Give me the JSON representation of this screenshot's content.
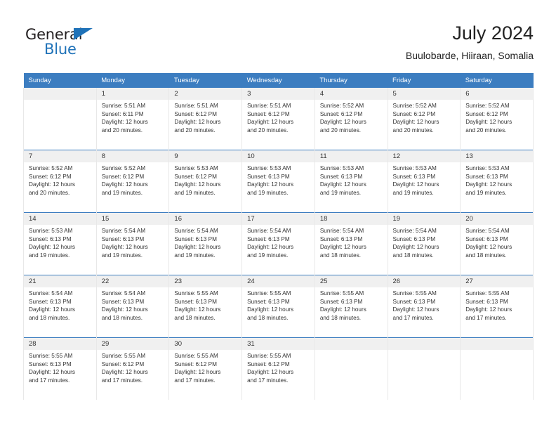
{
  "brand": {
    "name_part1": "General",
    "name_part2": "Blue",
    "triangle_icon": "triangle-icon",
    "accent_color": "#1f72b8"
  },
  "header": {
    "title": "July 2024",
    "subtitle": "Buulobarde, Hiiraan, Somalia"
  },
  "calendar": {
    "header_bg": "#3c7dc0",
    "daynum_bg": "#f0f0f0",
    "weekday_headers": [
      "Sunday",
      "Monday",
      "Tuesday",
      "Wednesday",
      "Thursday",
      "Friday",
      "Saturday"
    ],
    "weeks": [
      [
        {
          "day": "",
          "sunrise": "",
          "sunset": "",
          "daylight1": "",
          "daylight2": "",
          "blank": true
        },
        {
          "day": "1",
          "sunrise": "Sunrise: 5:51 AM",
          "sunset": "Sunset: 6:11 PM",
          "daylight1": "Daylight: 12 hours",
          "daylight2": "and 20 minutes."
        },
        {
          "day": "2",
          "sunrise": "Sunrise: 5:51 AM",
          "sunset": "Sunset: 6:12 PM",
          "daylight1": "Daylight: 12 hours",
          "daylight2": "and 20 minutes."
        },
        {
          "day": "3",
          "sunrise": "Sunrise: 5:51 AM",
          "sunset": "Sunset: 6:12 PM",
          "daylight1": "Daylight: 12 hours",
          "daylight2": "and 20 minutes."
        },
        {
          "day": "4",
          "sunrise": "Sunrise: 5:52 AM",
          "sunset": "Sunset: 6:12 PM",
          "daylight1": "Daylight: 12 hours",
          "daylight2": "and 20 minutes."
        },
        {
          "day": "5",
          "sunrise": "Sunrise: 5:52 AM",
          "sunset": "Sunset: 6:12 PM",
          "daylight1": "Daylight: 12 hours",
          "daylight2": "and 20 minutes."
        },
        {
          "day": "6",
          "sunrise": "Sunrise: 5:52 AM",
          "sunset": "Sunset: 6:12 PM",
          "daylight1": "Daylight: 12 hours",
          "daylight2": "and 20 minutes."
        }
      ],
      [
        {
          "day": "7",
          "sunrise": "Sunrise: 5:52 AM",
          "sunset": "Sunset: 6:12 PM",
          "daylight1": "Daylight: 12 hours",
          "daylight2": "and 20 minutes."
        },
        {
          "day": "8",
          "sunrise": "Sunrise: 5:52 AM",
          "sunset": "Sunset: 6:12 PM",
          "daylight1": "Daylight: 12 hours",
          "daylight2": "and 19 minutes."
        },
        {
          "day": "9",
          "sunrise": "Sunrise: 5:53 AM",
          "sunset": "Sunset: 6:12 PM",
          "daylight1": "Daylight: 12 hours",
          "daylight2": "and 19 minutes."
        },
        {
          "day": "10",
          "sunrise": "Sunrise: 5:53 AM",
          "sunset": "Sunset: 6:13 PM",
          "daylight1": "Daylight: 12 hours",
          "daylight2": "and 19 minutes."
        },
        {
          "day": "11",
          "sunrise": "Sunrise: 5:53 AM",
          "sunset": "Sunset: 6:13 PM",
          "daylight1": "Daylight: 12 hours",
          "daylight2": "and 19 minutes."
        },
        {
          "day": "12",
          "sunrise": "Sunrise: 5:53 AM",
          "sunset": "Sunset: 6:13 PM",
          "daylight1": "Daylight: 12 hours",
          "daylight2": "and 19 minutes."
        },
        {
          "day": "13",
          "sunrise": "Sunrise: 5:53 AM",
          "sunset": "Sunset: 6:13 PM",
          "daylight1": "Daylight: 12 hours",
          "daylight2": "and 19 minutes."
        }
      ],
      [
        {
          "day": "14",
          "sunrise": "Sunrise: 5:53 AM",
          "sunset": "Sunset: 6:13 PM",
          "daylight1": "Daylight: 12 hours",
          "daylight2": "and 19 minutes."
        },
        {
          "day": "15",
          "sunrise": "Sunrise: 5:54 AM",
          "sunset": "Sunset: 6:13 PM",
          "daylight1": "Daylight: 12 hours",
          "daylight2": "and 19 minutes."
        },
        {
          "day": "16",
          "sunrise": "Sunrise: 5:54 AM",
          "sunset": "Sunset: 6:13 PM",
          "daylight1": "Daylight: 12 hours",
          "daylight2": "and 19 minutes."
        },
        {
          "day": "17",
          "sunrise": "Sunrise: 5:54 AM",
          "sunset": "Sunset: 6:13 PM",
          "daylight1": "Daylight: 12 hours",
          "daylight2": "and 19 minutes."
        },
        {
          "day": "18",
          "sunrise": "Sunrise: 5:54 AM",
          "sunset": "Sunset: 6:13 PM",
          "daylight1": "Daylight: 12 hours",
          "daylight2": "and 18 minutes."
        },
        {
          "day": "19",
          "sunrise": "Sunrise: 5:54 AM",
          "sunset": "Sunset: 6:13 PM",
          "daylight1": "Daylight: 12 hours",
          "daylight2": "and 18 minutes."
        },
        {
          "day": "20",
          "sunrise": "Sunrise: 5:54 AM",
          "sunset": "Sunset: 6:13 PM",
          "daylight1": "Daylight: 12 hours",
          "daylight2": "and 18 minutes."
        }
      ],
      [
        {
          "day": "21",
          "sunrise": "Sunrise: 5:54 AM",
          "sunset": "Sunset: 6:13 PM",
          "daylight1": "Daylight: 12 hours",
          "daylight2": "and 18 minutes."
        },
        {
          "day": "22",
          "sunrise": "Sunrise: 5:54 AM",
          "sunset": "Sunset: 6:13 PM",
          "daylight1": "Daylight: 12 hours",
          "daylight2": "and 18 minutes."
        },
        {
          "day": "23",
          "sunrise": "Sunrise: 5:55 AM",
          "sunset": "Sunset: 6:13 PM",
          "daylight1": "Daylight: 12 hours",
          "daylight2": "and 18 minutes."
        },
        {
          "day": "24",
          "sunrise": "Sunrise: 5:55 AM",
          "sunset": "Sunset: 6:13 PM",
          "daylight1": "Daylight: 12 hours",
          "daylight2": "and 18 minutes."
        },
        {
          "day": "25",
          "sunrise": "Sunrise: 5:55 AM",
          "sunset": "Sunset: 6:13 PM",
          "daylight1": "Daylight: 12 hours",
          "daylight2": "and 18 minutes."
        },
        {
          "day": "26",
          "sunrise": "Sunrise: 5:55 AM",
          "sunset": "Sunset: 6:13 PM",
          "daylight1": "Daylight: 12 hours",
          "daylight2": "and 17 minutes."
        },
        {
          "day": "27",
          "sunrise": "Sunrise: 5:55 AM",
          "sunset": "Sunset: 6:13 PM",
          "daylight1": "Daylight: 12 hours",
          "daylight2": "and 17 minutes."
        }
      ],
      [
        {
          "day": "28",
          "sunrise": "Sunrise: 5:55 AM",
          "sunset": "Sunset: 6:13 PM",
          "daylight1": "Daylight: 12 hours",
          "daylight2": "and 17 minutes."
        },
        {
          "day": "29",
          "sunrise": "Sunrise: 5:55 AM",
          "sunset": "Sunset: 6:12 PM",
          "daylight1": "Daylight: 12 hours",
          "daylight2": "and 17 minutes."
        },
        {
          "day": "30",
          "sunrise": "Sunrise: 5:55 AM",
          "sunset": "Sunset: 6:12 PM",
          "daylight1": "Daylight: 12 hours",
          "daylight2": "and 17 minutes."
        },
        {
          "day": "31",
          "sunrise": "Sunrise: 5:55 AM",
          "sunset": "Sunset: 6:12 PM",
          "daylight1": "Daylight: 12 hours",
          "daylight2": "and 17 minutes."
        },
        {
          "day": "",
          "sunrise": "",
          "sunset": "",
          "daylight1": "",
          "daylight2": "",
          "blank": true
        },
        {
          "day": "",
          "sunrise": "",
          "sunset": "",
          "daylight1": "",
          "daylight2": "",
          "blank": true
        },
        {
          "day": "",
          "sunrise": "",
          "sunset": "",
          "daylight1": "",
          "daylight2": "",
          "blank": true
        }
      ]
    ]
  }
}
